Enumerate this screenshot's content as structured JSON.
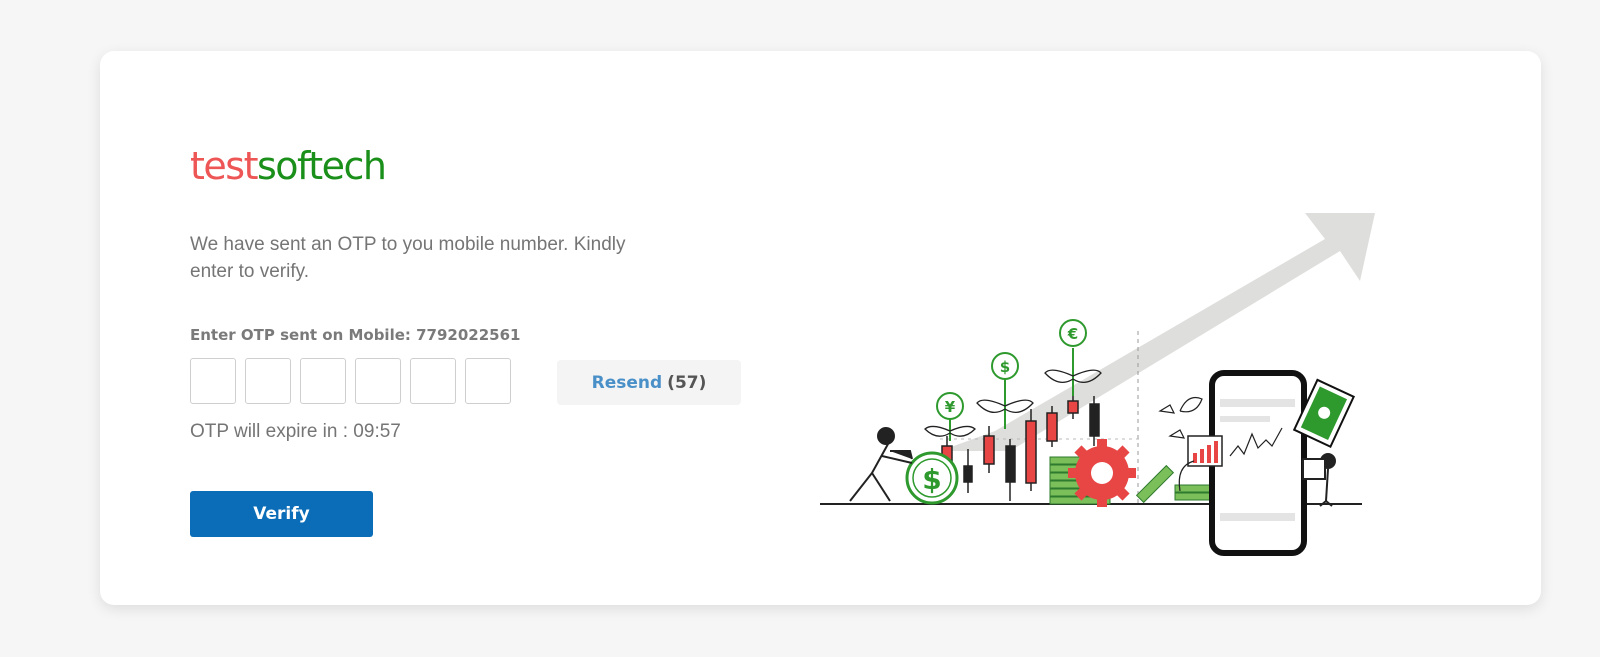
{
  "logo": {
    "part1": "test",
    "part2": "softech"
  },
  "intro_text": "We have sent an OTP to you mobile number. Kindly enter to verify.",
  "otp_label": "Enter OTP sent on Mobile: 7792022561",
  "otp_fields": [
    "",
    "",
    "",
    "",
    "",
    ""
  ],
  "resend": {
    "label": "Resend",
    "count": "(57)"
  },
  "expire_text": "OTP will expire in : 09:57",
  "verify_label": "Verify",
  "colors": {
    "logo_red": "#ee5555",
    "logo_green": "#1a8f1a",
    "primary": "#0b6db8",
    "link": "#4a90c8",
    "illustration_red": "#e84545",
    "illustration_green": "#2e9a2e"
  }
}
